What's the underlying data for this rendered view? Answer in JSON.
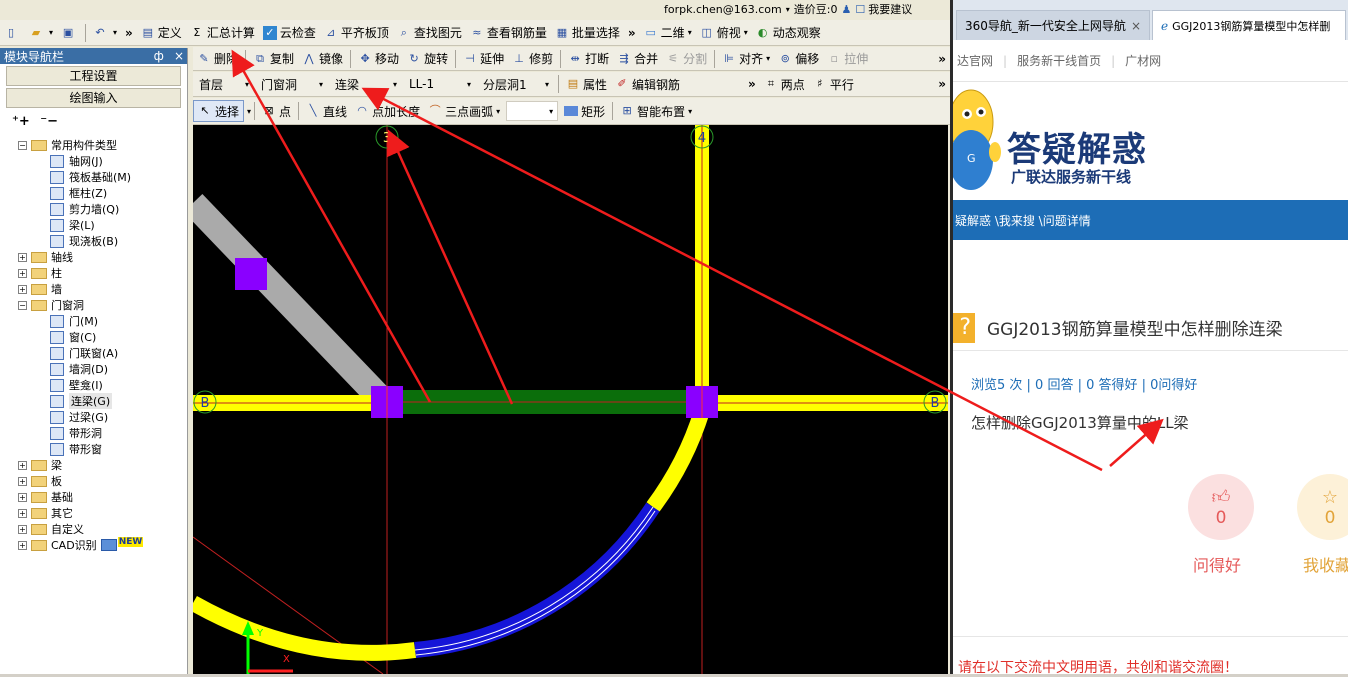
{
  "account": {
    "email": "forpk.chen@163.com",
    "cost_label": "造价豆:0",
    "help_label": "我要建议"
  },
  "toolbar1": {
    "items": [
      "定义",
      "汇总计算",
      "云检查",
      "平齐板顶",
      "查找图元",
      "查看钢筋量",
      "批量选择",
      "二维",
      "俯视",
      "动态观察"
    ]
  },
  "toolbar2": {
    "items": [
      "删除",
      "复制",
      "镜像",
      "移动",
      "旋转",
      "延伸",
      "修剪",
      "打断",
      "合并",
      "分割",
      "对齐",
      "偏移",
      "拉伸"
    ]
  },
  "toolbar3": {
    "floor": "首层",
    "category": "门窗洞",
    "type": "连梁",
    "name": "LL-1",
    "layer": "分层洞1",
    "property": "属性",
    "edit_rebar": "编辑钢筋",
    "two_points": "两点",
    "parallel": "平行"
  },
  "toolbar4": {
    "items": [
      "选择",
      "点",
      "直线",
      "点加长度",
      "三点画弧",
      "矩形",
      "智能布置"
    ]
  },
  "nav": {
    "title": "模块导航栏",
    "pin": "ф",
    "close": "×",
    "btn_project": "工程设置",
    "btn_draw": "绘图输入",
    "tree": [
      {
        "label": "常用构件类型",
        "level": 0,
        "exp": "−",
        "kind": "folder"
      },
      {
        "label": "轴网(J)",
        "level": 1,
        "kind": "comp"
      },
      {
        "label": "筏板基础(M)",
        "level": 1,
        "kind": "comp"
      },
      {
        "label": "框柱(Z)",
        "level": 1,
        "kind": "comp"
      },
      {
        "label": "剪力墙(Q)",
        "level": 1,
        "kind": "comp"
      },
      {
        "label": "梁(L)",
        "level": 1,
        "kind": "comp"
      },
      {
        "label": "现浇板(B)",
        "level": 1,
        "kind": "comp"
      },
      {
        "label": "轴线",
        "level": 0,
        "exp": "+",
        "kind": "folder"
      },
      {
        "label": "柱",
        "level": 0,
        "exp": "+",
        "kind": "folder"
      },
      {
        "label": "墙",
        "level": 0,
        "exp": "+",
        "kind": "folder"
      },
      {
        "label": "门窗洞",
        "level": 0,
        "exp": "−",
        "kind": "folder"
      },
      {
        "label": "门(M)",
        "level": 1,
        "kind": "comp"
      },
      {
        "label": "窗(C)",
        "level": 1,
        "kind": "comp"
      },
      {
        "label": "门联窗(A)",
        "level": 1,
        "kind": "comp"
      },
      {
        "label": "墙洞(D)",
        "level": 1,
        "kind": "comp"
      },
      {
        "label": "壁龛(I)",
        "level": 1,
        "kind": "comp"
      },
      {
        "label": "连梁(G)",
        "level": 1,
        "kind": "comp",
        "selected": true
      },
      {
        "label": "过梁(G)",
        "level": 1,
        "kind": "comp"
      },
      {
        "label": "带形洞",
        "level": 1,
        "kind": "comp"
      },
      {
        "label": "带形窗",
        "level": 1,
        "kind": "comp"
      },
      {
        "label": "梁",
        "level": 0,
        "exp": "+",
        "kind": "folder"
      },
      {
        "label": "板",
        "level": 0,
        "exp": "+",
        "kind": "folder"
      },
      {
        "label": "基础",
        "level": 0,
        "exp": "+",
        "kind": "folder"
      },
      {
        "label": "其它",
        "level": 0,
        "exp": "+",
        "kind": "folder"
      },
      {
        "label": "自定义",
        "level": 0,
        "exp": "+",
        "kind": "folder"
      },
      {
        "label": "CAD识别",
        "level": 0,
        "exp": "+",
        "kind": "folder",
        "badge": "NEW"
      }
    ]
  },
  "canvas": {
    "axis_labels": [
      "3",
      "4",
      "B",
      "B"
    ],
    "y_label": "Y",
    "x_label": "X"
  },
  "browser": {
    "tabs": [
      "360导航_新一代安全上网导航",
      "GGJ2013钢筋算量模型中怎样删"
    ],
    "nav_links": [
      "达官网",
      "服务新干线首页",
      "广材网"
    ],
    "banner_title": "答疑解惑",
    "banner_sub": "广联达服务新干线",
    "breadcrumb": "疑解惑 \\我来搜 \\问题详情",
    "question_title": "GGJ2013钢筋算量模型中怎样删除连梁",
    "stats": "浏览5 次 | 0 回答 | 0 答得好 | 0问得好",
    "question_body": "怎样删除GGJ2013算量中的LL梁",
    "like_count": "0",
    "like_label": "问得好",
    "fav_count": "0",
    "fav_label": "我收藏",
    "notice": "请在以下交流中文明用语，共创和谐交流圈！"
  },
  "colors": {
    "beam_green": "#0b6e0b",
    "axis_yellow": "#ffff00",
    "column_purple": "#8a00ff",
    "arc_blue": "#1515d8",
    "arrow_red": "#ee1c1c",
    "brand_blue": "#1d6db6"
  }
}
